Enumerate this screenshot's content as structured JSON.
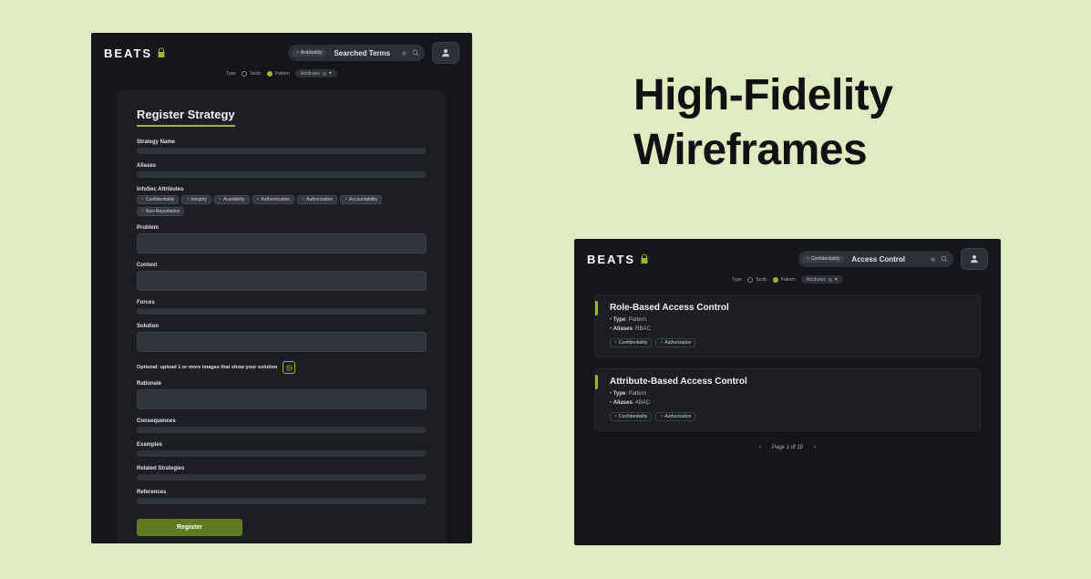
{
  "page_heading_line1": "High-Fidelity",
  "page_heading_line2": "Wireframes",
  "brand": "BEATS",
  "colors": {
    "accent": "#98b92e"
  },
  "left": {
    "search": {
      "chip": "Availability",
      "text": "Searched Terms"
    },
    "filter": {
      "type_label": "Type",
      "tactic": "Tactic",
      "pattern": "Pattern",
      "attributes_label": "Attributes"
    },
    "form": {
      "title": "Register Strategy",
      "fields": {
        "name_label": "Strategy Name",
        "aliases_label": "Aliases",
        "infosec_label": "InfoSec Attributes",
        "problem_label": "Problem",
        "context_label": "Context",
        "forces_label": "Forces",
        "solution_label": "Solution",
        "upload_label": "Optional: upload 1 or more images that show your solution",
        "rationale_label": "Rationale",
        "consequences_label": "Consequences",
        "examples_label": "Examples",
        "related_label": "Related Strategies",
        "references_label": "References",
        "submit": "Register"
      },
      "infosec_chips": [
        "Confidentiality",
        "Integrity",
        "Availability",
        "Authentication",
        "Authorization",
        "Accountability",
        "Non-Repudiation"
      ]
    }
  },
  "right": {
    "search": {
      "chip": "Confidentiality",
      "text": "Access Control"
    },
    "filter": {
      "type_label": "Type",
      "tactic": "Tactic",
      "pattern": "Pattern",
      "attributes_label": "Attributes"
    },
    "results": [
      {
        "title": "Role-Based Access Control",
        "type_k": "Type",
        "type_v": "Pattern",
        "aliases_k": "Aliases",
        "aliases_v": "RBAC",
        "tags": [
          "Confidentiality",
          "Authorization"
        ]
      },
      {
        "title": "Attribute-Based Access Control",
        "type_k": "Type",
        "type_v": "Pattern",
        "aliases_k": "Aliases",
        "aliases_v": "ABAC",
        "tags": [
          "Confidentiality",
          "Authorization"
        ]
      }
    ],
    "pager": "Page 1 of 19"
  }
}
